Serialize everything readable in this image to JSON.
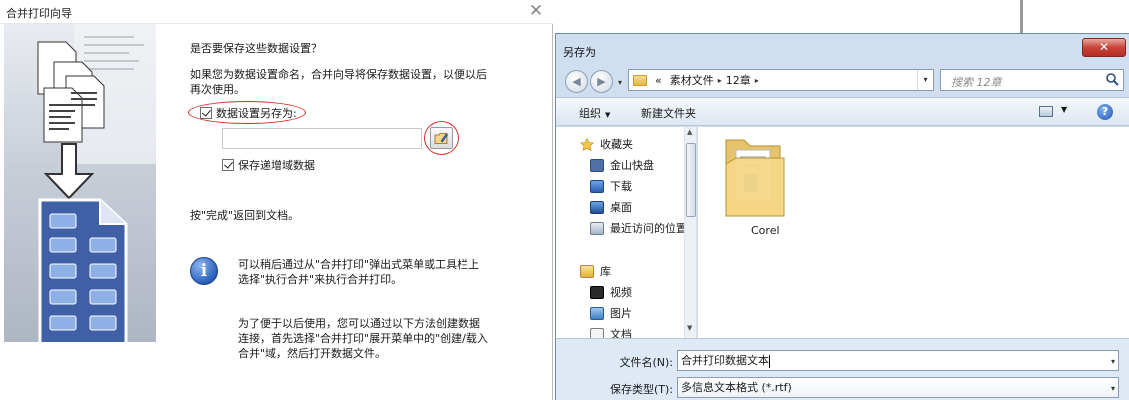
{
  "wizard": {
    "title": "合并打印向导",
    "close_glyph": "✕",
    "question": "是否要保存这些数据设置？",
    "description": "如果您为数据设置命名，合并向导将保存数据设置，以便以后再次使用。",
    "save_checkbox_label": "数据设置另存为:",
    "save_checked": true,
    "save_name_value": "",
    "incremental_label": "保存递增域数据",
    "incremental_checked": true,
    "finish_text": "按\"完成\"返回到文档。",
    "info_glyph": "i",
    "info1": "可以稍后通过从\"合并打印\"弹出式菜单或工具栏上选择\"执行合并\"来执行合并打印。",
    "info2": "为了便于以后使用，您可以通过以下方法创建数据连接，首先选择\"合并打印\"展开菜单中的\"创建/载入合并\"域，然后打开数据文件。"
  },
  "save_dialog": {
    "title": "另存为",
    "close_glyph": "✕",
    "back_glyph": "◀",
    "forward_glyph": "▶",
    "nav_dropdown_glyph": "▾",
    "breadcrumb": {
      "overflow": "«",
      "segments": [
        "素材文件",
        "12章"
      ],
      "separator": "▸",
      "dropdown_glyph": "▾"
    },
    "refresh_glyph": "↻",
    "search_placeholder": "搜索 12章",
    "toolbar": {
      "organize": "组织",
      "new_folder": "新建文件夹",
      "dropdown_glyph": "▼",
      "help_glyph": "?"
    },
    "nav_items": [
      {
        "label": "收藏夹",
        "icon": "star-icon"
      },
      {
        "label": "金山快盘",
        "icon": "kuaipan-icon"
      },
      {
        "label": "下载",
        "icon": "download-icon"
      },
      {
        "label": "桌面",
        "icon": "desktop-icon"
      },
      {
        "label": "最近访问的位置",
        "icon": "recent-icon"
      },
      {
        "label": "库",
        "icon": "library-icon"
      },
      {
        "label": "视频",
        "icon": "video-icon"
      },
      {
        "label": "图片",
        "icon": "picture-icon"
      },
      {
        "label": "文档",
        "icon": "document-icon"
      }
    ],
    "scroll_up_glyph": "▲",
    "scroll_down_glyph": "▼",
    "folders": [
      {
        "label": "Corel"
      }
    ],
    "filename_label": "文件名(N):",
    "filename_value": "合并打印数据文本",
    "filetype_label": "保存类型(T):",
    "filetype_value": "多信息文本格式 (*.rtf)",
    "select_glyph": "▾",
    "colors": {
      "frame": "#cfdff0",
      "close": "#c8443a",
      "accent": "#1f56b3"
    }
  }
}
